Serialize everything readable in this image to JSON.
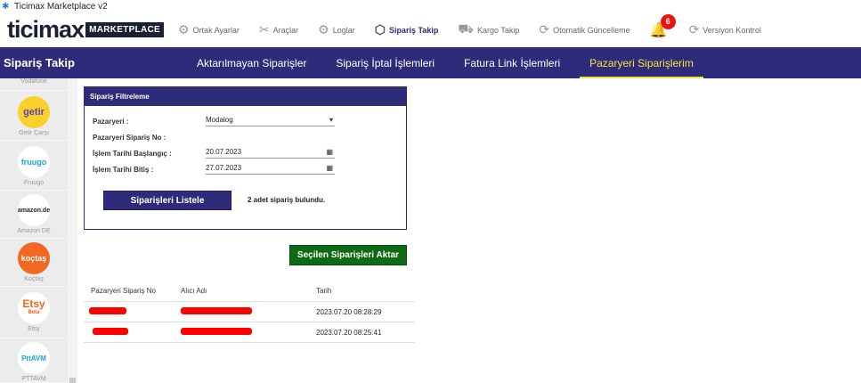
{
  "window": {
    "title": "Ticimax Marketplace v2"
  },
  "logo": {
    "text": "ticimax",
    "badge": "MARKETPLACE"
  },
  "topnav": [
    {
      "label": "Ortak Ayarlar",
      "icon": "gear-icon"
    },
    {
      "label": "Araçlar",
      "icon": "tools-icon"
    },
    {
      "label": "Loglar",
      "icon": "log-icon"
    },
    {
      "label": "Sipariş Takip",
      "icon": "box-icon",
      "active": true
    },
    {
      "label": "Kargo Takip",
      "icon": "truck-icon"
    },
    {
      "label": "Otomatik Güncelleme",
      "icon": "sync-icon"
    },
    {
      "label": "Versiyon Kontrol",
      "icon": "sync-icon"
    }
  ],
  "notifications": {
    "count": "6"
  },
  "mainnav": {
    "section_title": "Sipariş Takip",
    "tabs": [
      {
        "label": "Aktarılmayan Siparişler"
      },
      {
        "label": "Sipariş İptal İşlemleri"
      },
      {
        "label": "Fatura Link İşlemleri"
      },
      {
        "label": "Pazaryeri Siparişlerim",
        "active": true
      }
    ]
  },
  "sidebar": {
    "items": [
      {
        "name": "Vodafone",
        "logo_text": ""
      },
      {
        "name": "Getir Çarşı",
        "logo_text": "getir",
        "color": "#f9d12b",
        "text_color": "#5d3ebc"
      },
      {
        "name": "Fruugo",
        "logo_text": "fruugo",
        "color": "#ffffff",
        "text_color": "#1aa3d9"
      },
      {
        "name": "Amazon DE",
        "logo_text": "amazon.de",
        "color": "#ffffff",
        "text_color": "#222222"
      },
      {
        "name": "Koçtaş",
        "logo_text": "koçtaş",
        "color": "#f26722",
        "text_color": "#ffffff"
      },
      {
        "name": "Etsy",
        "logo_text": "Etsy",
        "sub_text": "Beta",
        "color": "#ffffff",
        "text_color": "#f1641e"
      },
      {
        "name": "PTTAVM",
        "logo_text": "PttAVM",
        "color": "#ffffff",
        "text_color": "#1aa3d9"
      }
    ]
  },
  "filter": {
    "title": "Sipariş Filtreleme",
    "pazaryeri_label": "Pazaryeri :",
    "pazaryeri_value": "Modalog",
    "siparis_no_label": "Pazaryeri Sipariş No :",
    "siparis_no_value": "",
    "baslangic_label": "İşlem Tarihi Başlangıç :",
    "baslangic_value": "20.07.2023",
    "bitis_label": "İşlem Tarihi Bitiş :",
    "bitis_value": "27.07.2023",
    "list_button": "Siparişleri Listele",
    "result_text": "2 adet sipariş bulundu."
  },
  "actions": {
    "aktar_button": "Seçilen Siparişleri Aktar"
  },
  "table": {
    "headers": [
      "Pazaryeri Sipariş No",
      "Alıcı Adı",
      "Tarih"
    ],
    "rows": [
      {
        "date": "2023.07.20 08:28:29"
      },
      {
        "date": "2023.07.20 08:25:41"
      }
    ]
  },
  "colors": {
    "brand_navy": "#2e2c7a",
    "active_tab": "#f5e23a",
    "aktar_green": "#0c6b12",
    "notification_red": "#ee1111"
  }
}
